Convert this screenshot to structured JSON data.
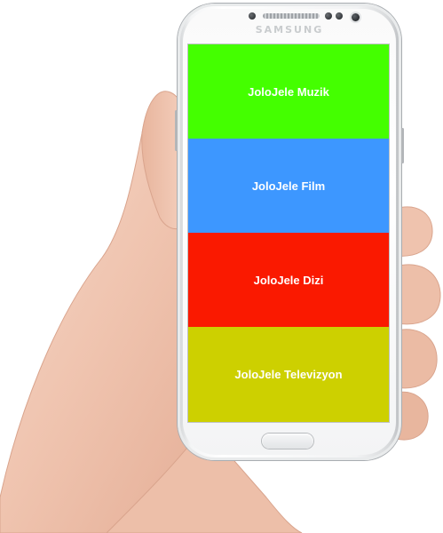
{
  "device": {
    "brand": "SAMSUNG"
  },
  "app": {
    "menu": [
      {
        "label": "JoloJele Muzik",
        "color": "#44ff00"
      },
      {
        "label": "JoloJele Film",
        "color": "#3d97ff"
      },
      {
        "label": "JoloJele Dizi",
        "color": "#fa1900"
      },
      {
        "label": "JoloJele Televizyon",
        "color": "#cdd000"
      }
    ]
  },
  "colors": {
    "skin": "#f2c9b5",
    "phone_body": "#f4f5f6"
  }
}
